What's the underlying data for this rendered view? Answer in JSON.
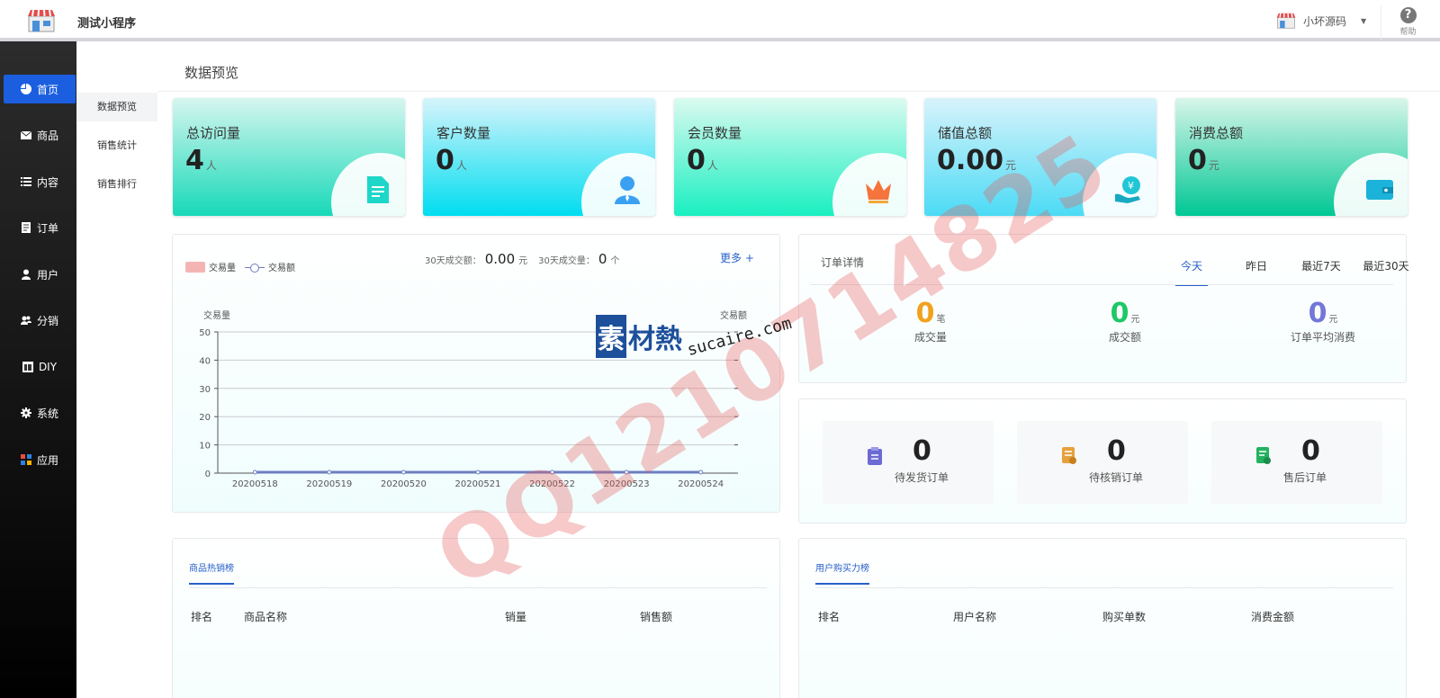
{
  "header": {
    "app_title": "测试小程序",
    "user_name": "小坏源码",
    "help_label": "帮助"
  },
  "sidebar": {
    "items": [
      {
        "label": "首页",
        "icon": "pie-chart-icon",
        "active": true
      },
      {
        "label": "商品",
        "icon": "envelope-icon"
      },
      {
        "label": "内容",
        "icon": "list-icon"
      },
      {
        "label": "订单",
        "icon": "document-icon"
      },
      {
        "label": "用户",
        "icon": "user-icon"
      },
      {
        "label": "分销",
        "icon": "users-icon"
      },
      {
        "label": "DIY",
        "icon": "layout-icon"
      },
      {
        "label": "系统",
        "icon": "gear-icon"
      },
      {
        "label": "应用",
        "icon": "apps-icon"
      }
    ]
  },
  "subnav": {
    "items": [
      {
        "label": "数据预览",
        "active": true
      },
      {
        "label": "销售统计"
      },
      {
        "label": "销售排行"
      }
    ]
  },
  "page": {
    "title": "数据预览"
  },
  "stats": [
    {
      "label": "总访问量",
      "value": "4",
      "unit": "人",
      "icon": "document-icon",
      "gradient": [
        "#d6f6f0",
        "#17d9b8"
      ]
    },
    {
      "label": "客户数量",
      "value": "0",
      "unit": "人",
      "icon": "user-icon",
      "gradient": [
        "#d6f4fb",
        "#00ddf0"
      ]
    },
    {
      "label": "会员数量",
      "value": "0",
      "unit": "人",
      "icon": "crown-icon",
      "gradient": [
        "#dbfaf0",
        "#19efc1"
      ]
    },
    {
      "label": "储值总额",
      "value": "0.00",
      "unit": "元",
      "icon": "money-hand-icon",
      "gradient": [
        "#d8f3fb",
        "#4cdbf5"
      ]
    },
    {
      "label": "消费总额",
      "value": "0",
      "unit": "元",
      "icon": "wallet-icon",
      "gradient": [
        "#d8f6ea",
        "#00c794"
      ]
    }
  ],
  "trade": {
    "legend_bar": "交易量",
    "legend_line": "交易额",
    "summary_amount_label": "30天成交额：",
    "summary_amount": "0.00",
    "summary_amount_unit": "元",
    "summary_count_label": "30天成交量：",
    "summary_count": "0",
    "summary_count_unit": "个",
    "more_label": "更多 +"
  },
  "chart_data": {
    "type": "bar",
    "categories": [
      "20200518",
      "20200519",
      "20200520",
      "20200521",
      "20200522",
      "20200523",
      "20200524"
    ],
    "series": [
      {
        "name": "交易量",
        "type": "bar",
        "values": [
          0,
          0,
          0,
          0,
          0,
          0,
          0
        ],
        "color": "#f5b4b4"
      },
      {
        "name": "交易额",
        "type": "line",
        "values": [
          0,
          0,
          0,
          0,
          0,
          0,
          0
        ],
        "color": "#6e7ec0"
      }
    ],
    "ylabel": "交易量",
    "y2label": "交易额",
    "ylim": [
      0,
      50
    ],
    "yticks": [
      0,
      10,
      20,
      30,
      40,
      50
    ],
    "grid": true,
    "legend": "top-left"
  },
  "order_detail": {
    "title": "订单详情",
    "tabs": [
      "今天",
      "昨日",
      "最近7天",
      "最近30天"
    ],
    "stats": [
      {
        "value": "0",
        "unit": "笔",
        "label": "成交量",
        "color": "#f1a21d"
      },
      {
        "value": "0",
        "unit": "元",
        "label": "成交额",
        "color": "#1fc766"
      },
      {
        "value": "0",
        "unit": "元",
        "label": "订单平均消费",
        "color": "#7277d8"
      }
    ]
  },
  "order_status": [
    {
      "value": "0",
      "label": "待发货订单",
      "icon": "clipboard-icon",
      "color": "#6c6ad3"
    },
    {
      "value": "0",
      "label": "待核销订单",
      "icon": "verify-icon",
      "color": "#e6a13c"
    },
    {
      "value": "0",
      "label": "售后订单",
      "icon": "aftersale-icon",
      "color": "#24b25f"
    }
  ],
  "hot_products": {
    "tab": "商品热销榜",
    "columns": [
      "排名",
      "商品名称",
      "销量",
      "销售额"
    ]
  },
  "buyer_ranking": {
    "tab": "用户购买力榜",
    "columns": [
      "排名",
      "用户名称",
      "购买单数",
      "消费金额"
    ]
  },
  "watermark": {
    "text": "QQ1210714825",
    "brand_a": "素",
    "brand_b": "材熱",
    "brand_url": "sucaire.com"
  }
}
